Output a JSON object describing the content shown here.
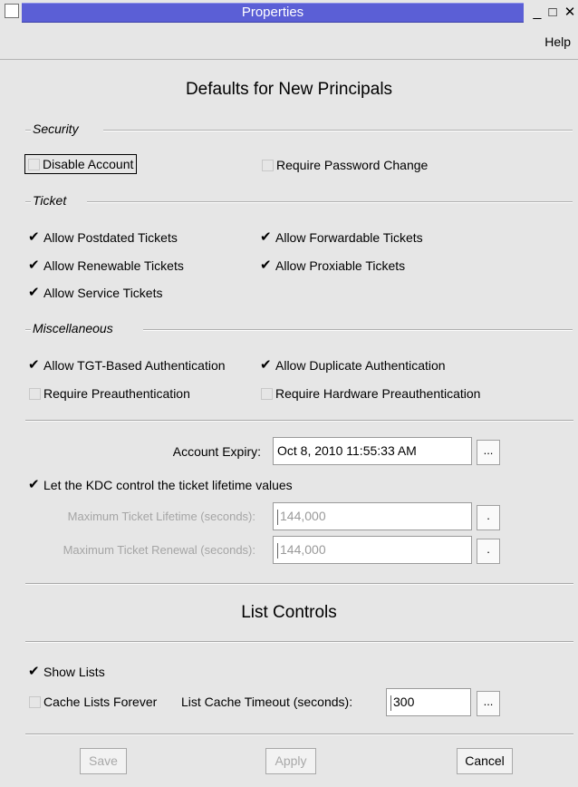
{
  "window": {
    "title": "Properties",
    "minimize_glyph": "_",
    "maximize_glyph": "□",
    "close_glyph": "✕"
  },
  "menu": {
    "help": "Help"
  },
  "heading": "Defaults for New Principals",
  "security": {
    "title": "Security",
    "disable_account": {
      "label": "Disable Account",
      "checked": false
    },
    "require_password_change": {
      "label": "Require Password Change",
      "checked": false
    }
  },
  "ticket": {
    "title": "Ticket",
    "allow_postdated": {
      "label": "Allow Postdated Tickets",
      "checked": true
    },
    "allow_forwardable": {
      "label": "Allow Forwardable Tickets",
      "checked": true
    },
    "allow_renewable": {
      "label": "Allow Renewable Tickets",
      "checked": true
    },
    "allow_proxiable": {
      "label": "Allow Proxiable Tickets",
      "checked": true
    },
    "allow_service": {
      "label": "Allow Service Tickets",
      "checked": true
    }
  },
  "misc": {
    "title": "Miscellaneous",
    "allow_tgt": {
      "label": "Allow TGT-Based Authentication",
      "checked": true
    },
    "allow_duplicate": {
      "label": "Allow Duplicate Authentication",
      "checked": true
    },
    "require_preauth": {
      "label": "Require Preauthentication",
      "checked": false
    },
    "require_hw_preauth": {
      "label": "Require Hardware Preauthentication",
      "checked": false
    }
  },
  "expiry": {
    "label": "Account Expiry:",
    "value": "Oct 8, 2010 11:55:33 AM",
    "button": "..."
  },
  "kdc_control": {
    "label": "Let the KDC control the ticket lifetime values",
    "checked": true
  },
  "max_lifetime": {
    "label": "Maximum Ticket Lifetime (seconds):",
    "value": "144,000",
    "button": "."
  },
  "max_renewal": {
    "label": "Maximum Ticket Renewal (seconds):",
    "value": "144,000",
    "button": "."
  },
  "list_controls": {
    "heading": "List Controls",
    "show_lists": {
      "label": "Show Lists",
      "checked": true
    },
    "cache_forever": {
      "label": "Cache Lists Forever",
      "checked": false
    },
    "timeout_label": "List Cache Timeout (seconds):",
    "timeout_value": "300",
    "timeout_button": "..."
  },
  "buttons": {
    "save": "Save",
    "apply": "Apply",
    "cancel": "Cancel"
  }
}
